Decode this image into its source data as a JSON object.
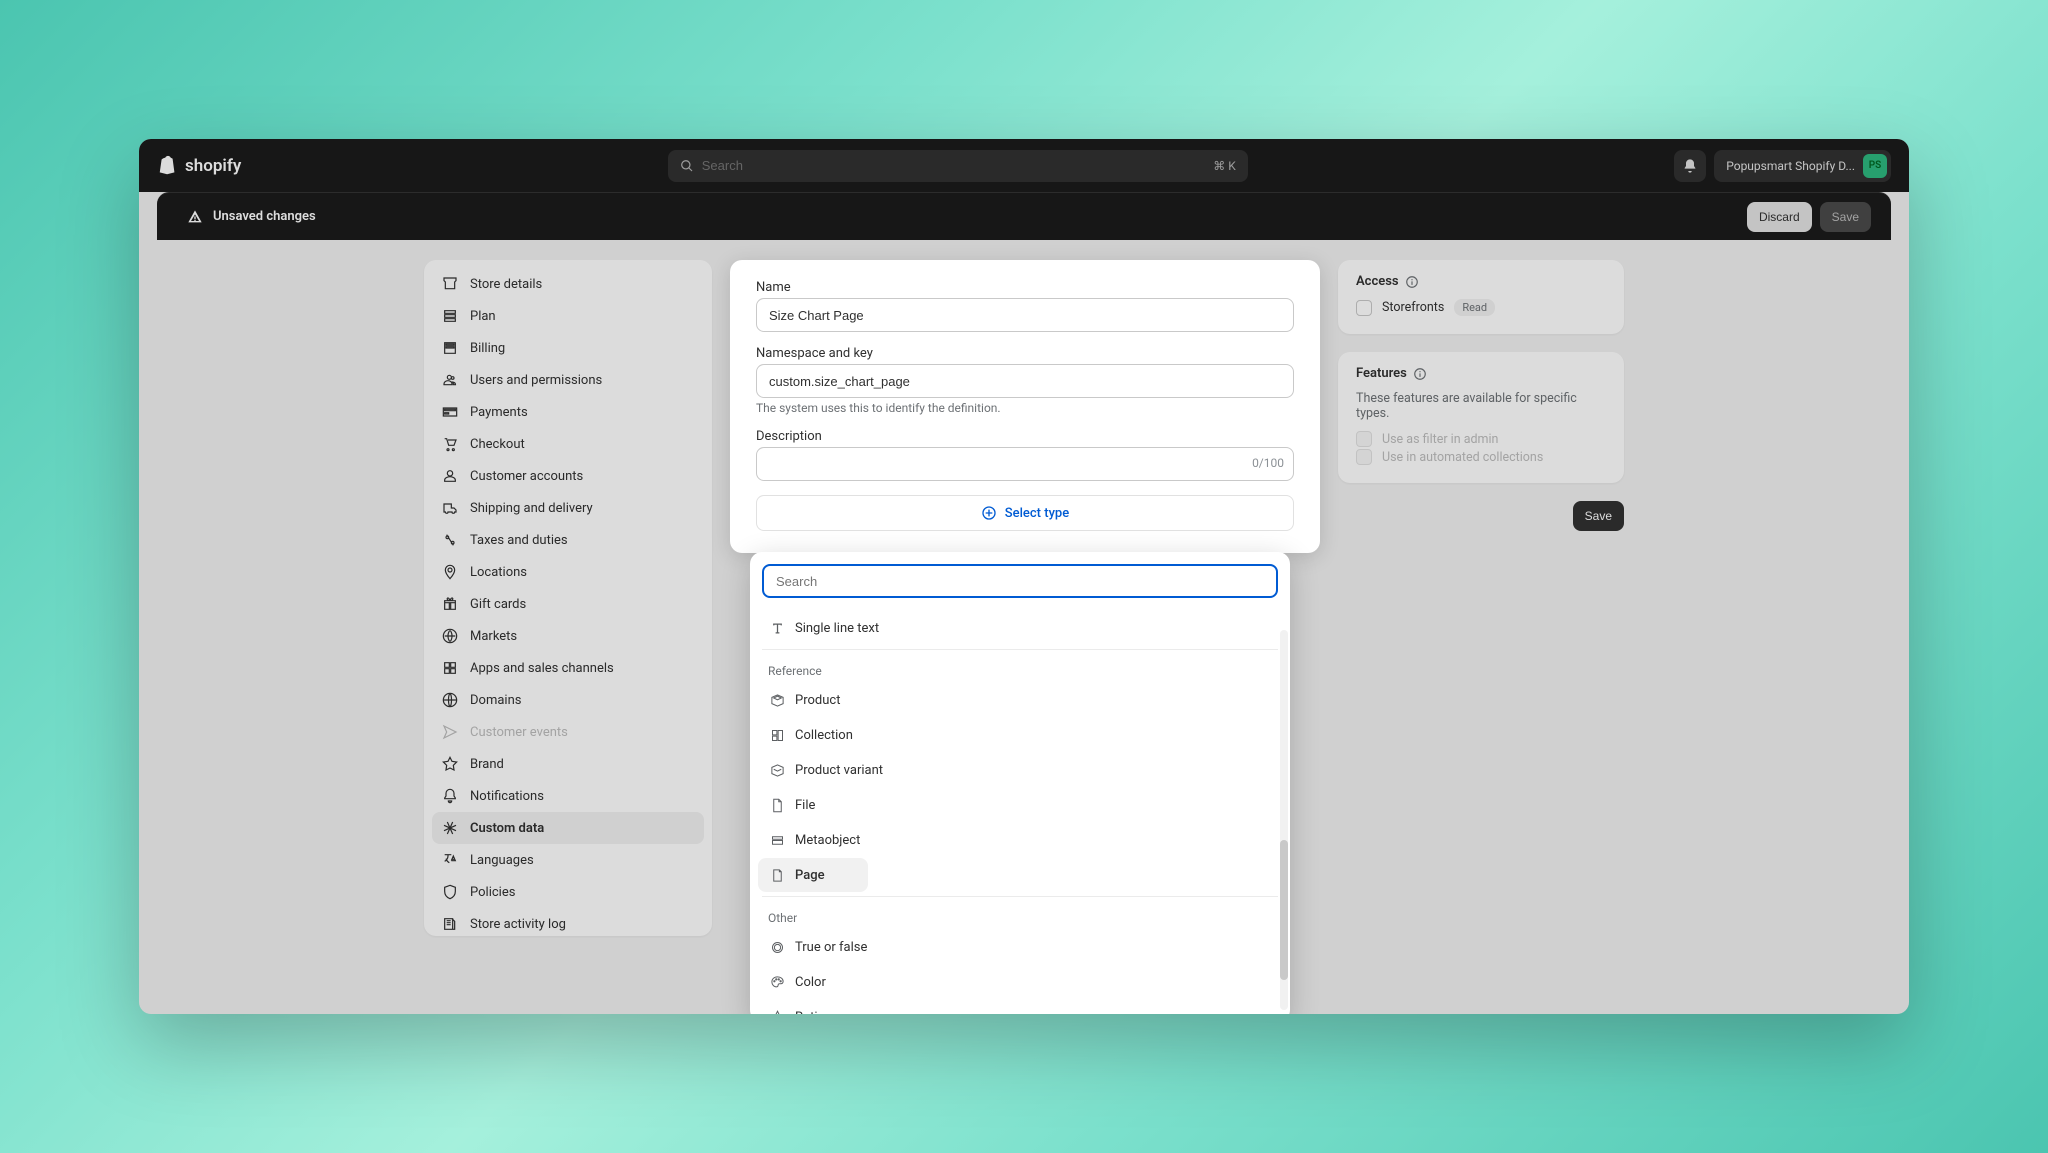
{
  "topbar": {
    "logo_text": "shopify",
    "search_placeholder": "Search",
    "kbd_shortcut": "⌘ K",
    "store_name": "Popupsmart Shopify D...",
    "avatar_initials": "PS"
  },
  "subbar": {
    "title": "Unsaved changes",
    "discard": "Discard",
    "save": "Save"
  },
  "nav": {
    "items": [
      "Store details",
      "Plan",
      "Billing",
      "Users and permissions",
      "Payments",
      "Checkout",
      "Customer accounts",
      "Shipping and delivery",
      "Taxes and duties",
      "Locations",
      "Gift cards",
      "Markets",
      "Apps and sales channels",
      "Domains",
      "Customer events",
      "Brand",
      "Notifications",
      "Custom data",
      "Languages",
      "Policies",
      "Store activity log"
    ],
    "active_index": 17,
    "muted_index": 14
  },
  "form": {
    "name_label": "Name",
    "name_value": "Size Chart Page",
    "ns_label": "Namespace and key",
    "ns_value": "custom.size_chart_page",
    "ns_help": "The system uses this to identify the definition.",
    "desc_label": "Description",
    "desc_counter": "0/100",
    "select_type": "Select type"
  },
  "dropdown": {
    "search_placeholder": "Search",
    "top_item": "Single line text",
    "group_reference": "Reference",
    "reference_items": [
      "Product",
      "Collection",
      "Product variant",
      "File",
      "Metaobject",
      "Page"
    ],
    "selected_reference": "Page",
    "group_other": "Other",
    "other_items": [
      "True or false",
      "Color",
      "Rating"
    ]
  },
  "access": {
    "title": "Access",
    "storefronts": "Storefronts",
    "read_badge": "Read"
  },
  "features": {
    "title": "Features",
    "desc": "These features are available for specific types.",
    "filter": "Use as filter in admin",
    "auto": "Use in automated collections"
  },
  "bottom_save": "Save"
}
